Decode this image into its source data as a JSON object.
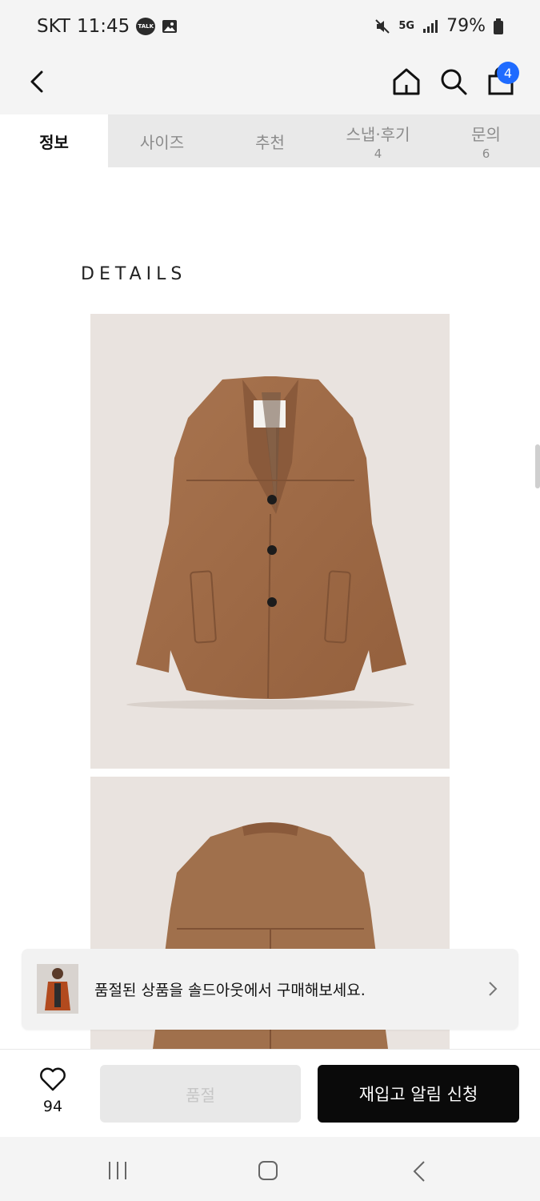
{
  "status": {
    "carrier": "SKT",
    "time": "11:45",
    "talk_label": "TALK",
    "network": "5G",
    "battery": "79%"
  },
  "header": {
    "cart_count": "4"
  },
  "tabs": [
    {
      "label": "정보",
      "count": ""
    },
    {
      "label": "사이즈",
      "count": ""
    },
    {
      "label": "추천",
      "count": ""
    },
    {
      "label": "스냅·후기",
      "count": "4"
    },
    {
      "label": "문의",
      "count": "6"
    }
  ],
  "content": {
    "heading": "DETAILS"
  },
  "banner": {
    "text": "품절된 상품을 솔드아웃에서 구매해보세요."
  },
  "bottom": {
    "wish_count": "94",
    "soldout_label": "품절",
    "restock_label": "재입고 알림 신청"
  },
  "colors": {
    "accent": "#1f6bff",
    "coat": "#a06d4a",
    "photo_bg": "#e9e3df",
    "cta": "#0a0a0a"
  }
}
